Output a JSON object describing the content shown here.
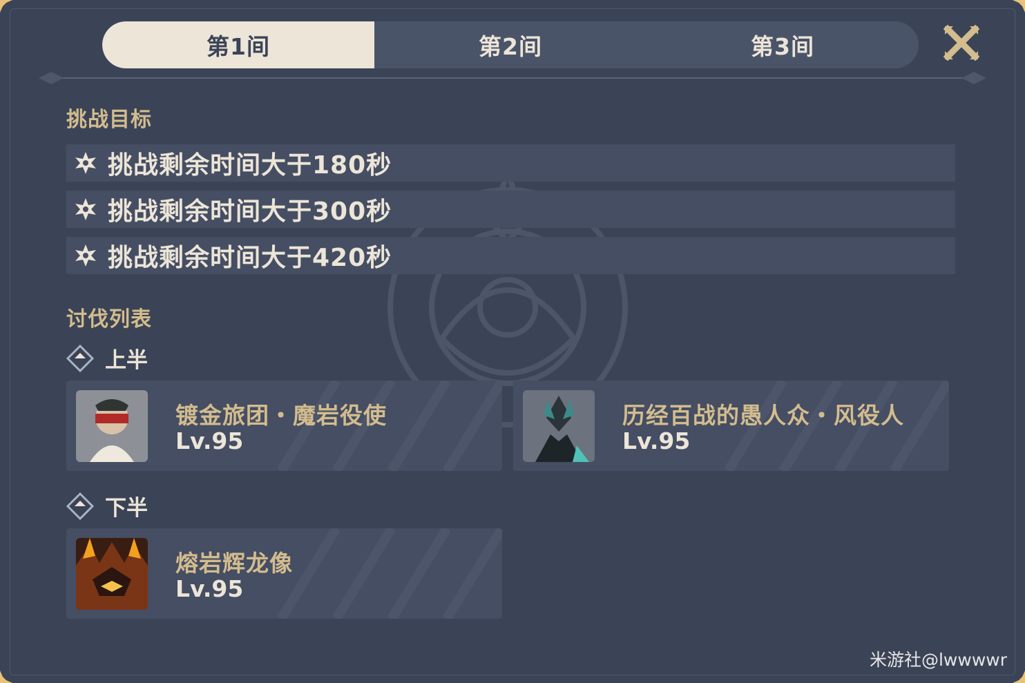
{
  "tabs": [
    {
      "label": "第1间",
      "active": true
    },
    {
      "label": "第2间",
      "active": false
    },
    {
      "label": "第3间",
      "active": false
    }
  ],
  "close_icon": "close-x-icon",
  "challenge": {
    "title": "挑战目标",
    "goals": [
      "挑战剩余时间大于180秒",
      "挑战剩余时间大于300秒",
      "挑战剩余时间大于420秒"
    ],
    "goal_icon": "star-icon"
  },
  "enemy_list": {
    "title": "讨伐列表",
    "first_half": {
      "label": "上半",
      "enemies": [
        {
          "name": "镀金旅团・魔岩役使",
          "level": "Lv.95"
        },
        {
          "name": "历经百战的愚人众・风役人",
          "level": "Lv.95"
        }
      ]
    },
    "second_half": {
      "label": "下半",
      "enemies": [
        {
          "name": "熔岩辉龙像",
          "level": "Lv.95"
        }
      ]
    }
  },
  "watermark": "米游社@lwwwwr",
  "colors": {
    "background": "#3b4456",
    "row": "#454e62",
    "gold": "#d3bc8e",
    "cream": "#ece5d8"
  }
}
